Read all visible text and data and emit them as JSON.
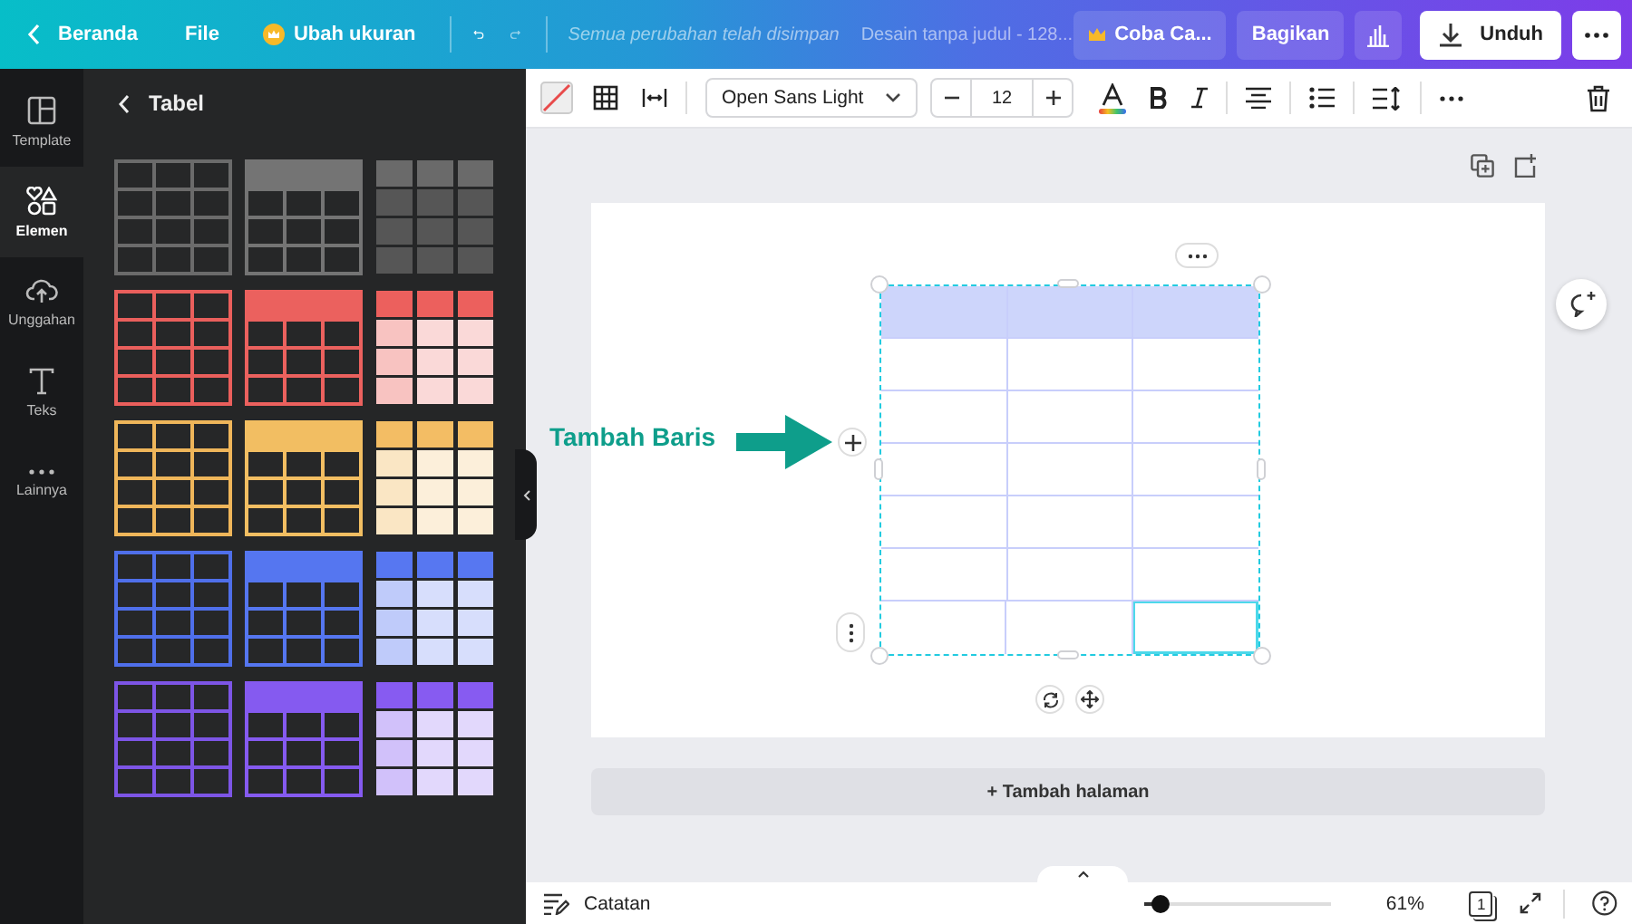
{
  "topbar": {
    "back_label": "Beranda",
    "menu_label": "File",
    "resize_label": "Ubah ukuran",
    "save_status": "Semua perubahan telah disimpan",
    "doc_title": "Desain tanpa judul - 128...",
    "trial_label": "Coba Ca...",
    "share_label": "Bagikan",
    "download_label": "Unduh"
  },
  "rail": [
    {
      "label": "Template",
      "kind": "layout",
      "selected": false
    },
    {
      "label": "Elemen",
      "kind": "shapes",
      "selected": true
    },
    {
      "label": "Unggahan",
      "kind": "upload",
      "selected": false
    },
    {
      "label": "Teks",
      "kind": "text",
      "selected": false
    },
    {
      "label": "Lainnya",
      "kind": "more",
      "selected": false
    }
  ],
  "panel": {
    "title": "Tabel",
    "templates": [
      {
        "kind": "grid",
        "color": "#6b6b6b"
      },
      {
        "kind": "header",
        "color": "#747474"
      },
      {
        "kind": "dark-tiles",
        "color": "#6a6a6a"
      },
      {
        "kind": "grid",
        "color": "#ea5f5c"
      },
      {
        "kind": "header",
        "color": "#eb615e"
      },
      {
        "kind": "tiles",
        "color": "#ec605d"
      },
      {
        "kind": "grid",
        "color": "#efb65a"
      },
      {
        "kind": "header",
        "color": "#f2be62"
      },
      {
        "kind": "tiles",
        "color": "#f3bd64"
      },
      {
        "kind": "grid",
        "color": "#4f6fea"
      },
      {
        "kind": "header",
        "color": "#5576f0"
      },
      {
        "kind": "tiles",
        "color": "#5777f1"
      },
      {
        "kind": "grid",
        "color": "#7d55e6"
      },
      {
        "kind": "header",
        "color": "#855af0"
      },
      {
        "kind": "tiles",
        "color": "#875bf1"
      }
    ]
  },
  "toolbar": {
    "font": "Open Sans Light",
    "size": "12"
  },
  "canvas": {
    "annotation": "Tambah Baris",
    "table": {
      "rows": [
        {
          "header": true,
          "cells": [
            {
              "selected": false
            },
            {
              "selected": false
            },
            {
              "selected": false
            }
          ]
        },
        {
          "header": false,
          "cells": [
            {
              "selected": false
            },
            {
              "selected": false
            },
            {
              "selected": false
            }
          ]
        },
        {
          "header": false,
          "cells": [
            {
              "selected": false
            },
            {
              "selected": false
            },
            {
              "selected": false
            }
          ]
        },
        {
          "header": false,
          "cells": [
            {
              "selected": false
            },
            {
              "selected": false
            },
            {
              "selected": false
            }
          ]
        },
        {
          "header": false,
          "cells": [
            {
              "selected": false
            },
            {
              "selected": false
            },
            {
              "selected": false
            }
          ]
        },
        {
          "header": false,
          "cells": [
            {
              "selected": false
            },
            {
              "selected": false
            },
            {
              "selected": false
            }
          ]
        },
        {
          "header": false,
          "cells": [
            {
              "selected": false
            },
            {
              "selected": false
            },
            {
              "selected": true
            }
          ]
        }
      ]
    },
    "add_page": "+ Tambah halaman"
  },
  "footer": {
    "notes": "Catatan",
    "zoom": {
      "level": 0.09,
      "reading": "61%"
    },
    "page_count": "1"
  }
}
